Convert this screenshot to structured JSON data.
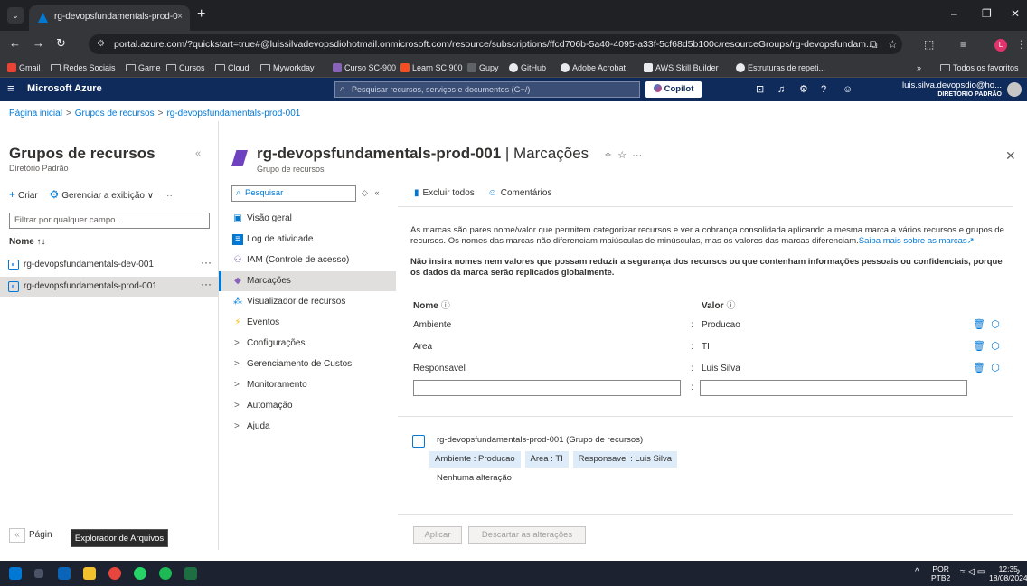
{
  "browser": {
    "tab_title": "rg-devopsfundamentals-prod-0",
    "tab_close": "×",
    "new_tab": "+",
    "url": "portal.azure.com/?quickstart=true#@luissilvadevopsdiohotmail.onmicrosoft.com/resource/subscriptions/ffcd706b-5a40-4095-a33f-5cf68d5b100c/resourceGroups/rg-devopsfundam...",
    "bookmarks": [
      "Gmail",
      "Redes Sociais",
      "Game",
      "Cursos",
      "Cloud",
      "Myworkday",
      "Curso SC-900",
      "Learn SC 900",
      "Gupy",
      "GitHub",
      "Adobe Acrobat",
      "AWS Skill Builder",
      "Estruturas de repeti..."
    ],
    "bookmarks_more": "»",
    "all_bookmarks": "Todos os favoritos",
    "profile_initial": "L"
  },
  "azure": {
    "brand": "Microsoft Azure",
    "search_placeholder": "Pesquisar recursos, serviços e documentos (G+/)",
    "copilot": "Copilot",
    "user_name": "luis.silva.devopsdio@ho...",
    "user_dir": "DIRETÓRIO PADRÃO"
  },
  "breadcrumb": [
    "Página inicial",
    "Grupos de recursos",
    "rg-devopsfundamentals-prod-001"
  ],
  "left_pane": {
    "title": "Grupos de recursos",
    "subtitle": "Diretório Padrão",
    "create": "Criar",
    "manage_view": "Gerenciar a exibição",
    "filter_placeholder": "Filtrar por qualquer campo...",
    "col_name": "Nome ↑↓",
    "rows": [
      "rg-devopsfundamentals-dev-001",
      "rg-devopsfundamentals-prod-001"
    ],
    "footer": "Págin"
  },
  "tooltip": "Explorador de Arquivos",
  "blade": {
    "title": "rg-devopsfundamentals-prod-001",
    "title_tail": " | Marcações",
    "subtitle": "Grupo de recursos",
    "menu_search": "Pesquisar",
    "menu": [
      {
        "label": "Visão geral",
        "icon": "overview-icon"
      },
      {
        "label": "Log de atividade",
        "icon": "activity-log-icon"
      },
      {
        "label": "IAM (Controle de acesso)",
        "icon": "iam-icon"
      },
      {
        "label": "Marcações",
        "icon": "tag-icon"
      },
      {
        "label": "Visualizador de recursos",
        "icon": "resource-visualizer-icon"
      },
      {
        "label": "Eventos",
        "icon": "events-icon"
      },
      {
        "label": "Configurações",
        "icon": "chevron-right-icon"
      },
      {
        "label": "Gerenciamento de Custos",
        "icon": "chevron-right-icon"
      },
      {
        "label": "Monitoramento",
        "icon": "chevron-right-icon"
      },
      {
        "label": "Automação",
        "icon": "chevron-right-icon"
      },
      {
        "label": "Ajuda",
        "icon": "chevron-right-icon"
      }
    ]
  },
  "tags": {
    "delete_all": "Excluir todos",
    "feedback": "Comentários",
    "description": "As marcas são pares nome/valor que permitem categorizar recursos e ver a cobrança consolidada aplicando a mesma marca a vários recursos e grupos de recursos. Os nomes das marcas não diferenciam maiúsculas de minúsculas, mas os valores das marcas diferenciam.",
    "learn_more": "Saiba mais sobre as marcas",
    "warning": "Não insira nomes nem valores que possam reduzir a segurança dos recursos ou que contenham informações pessoais ou confidenciais, porque os dados da marca serão replicados globalmente.",
    "col_name": "Nome",
    "col_value": "Valor",
    "rows": [
      {
        "name": "Ambiente",
        "value": "Producao"
      },
      {
        "name": "Area",
        "value": "TI"
      },
      {
        "name": "Responsavel",
        "value": "Luis Silva"
      }
    ],
    "colon": ":",
    "summary_title": "rg-devopsfundamentals-prod-001  (Grupo de recursos)",
    "chips": [
      "Ambiente : Producao",
      "Area : TI",
      "Responsavel : Luis Silva"
    ],
    "no_change": "Nenhuma alteração",
    "apply": "Aplicar",
    "discard": "Descartar as alterações"
  },
  "taskbar": {
    "lang_1": "POR",
    "lang_2": "PTB2",
    "time": "12:35",
    "date": "18/08/2024"
  }
}
